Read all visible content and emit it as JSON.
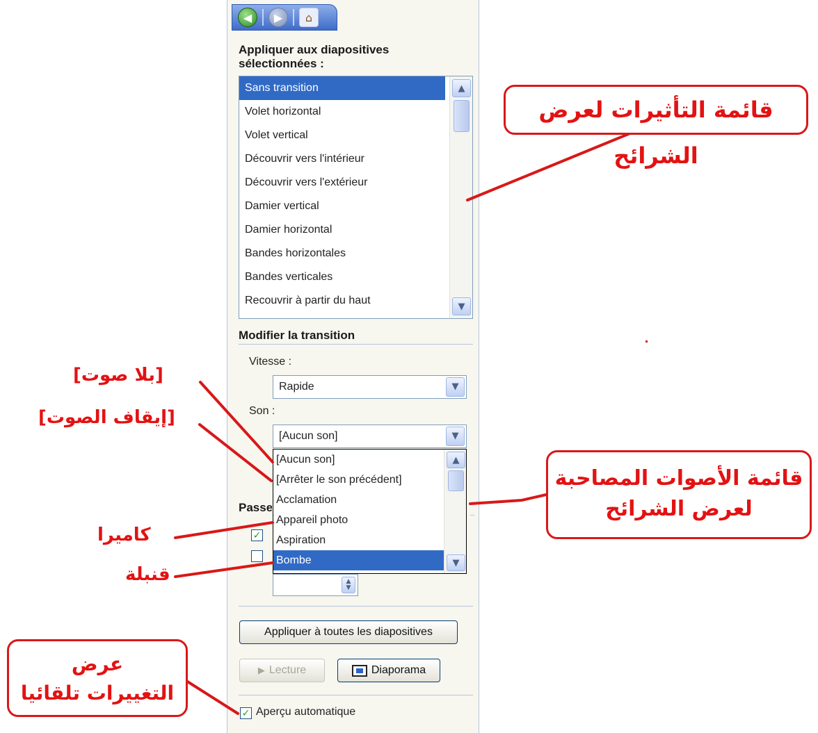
{
  "nav": {
    "back_icon": "◀",
    "forward_icon": "▶",
    "home_icon": "⌂"
  },
  "apply_section": {
    "title": "Appliquer aux diapositives sélectionnées :"
  },
  "transitions": {
    "items": [
      "Sans transition",
      "Volet horizontal",
      "Volet vertical",
      "Découvrir vers l'intérieur",
      "Découvrir vers l'extérieur",
      "Damier vertical",
      "Damier horizontal",
      "Bandes horizontales",
      "Bandes verticales",
      "Recouvrir à partir du haut"
    ],
    "selected_index": 0
  },
  "modify": {
    "title": "Modifier la transition",
    "speed_label": "Vitesse :",
    "speed_value": "Rapide",
    "sound_label": "Son :",
    "sound_value": "[Aucun son]"
  },
  "sound_list": {
    "items": [
      "[Aucun son]",
      "[Arrêter le son précédent]",
      "Acclamation",
      "Appareil photo",
      "Aspiration",
      "Bombe"
    ],
    "selected_index": 5
  },
  "advance": {
    "partial_label": "Passe"
  },
  "buttons": {
    "apply_all": "Appliquer à toutes les diapositives",
    "play": "Lecture",
    "slideshow": "Diaporama"
  },
  "auto_preview": {
    "label": "Aperçu automatique",
    "checked": true
  },
  "annotations": {
    "effects_list": "قائمة التأثيرات لعرض الشرائح",
    "no_sound": "[بلا صوت]",
    "stop_sound": "[إيقاف الصوت]",
    "sounds_list_line1": "قائمة الأصوات المصاحبة",
    "sounds_list_line2": "لعرض الشرائح",
    "camera": "كاميرا",
    "bomb": "قنبلة",
    "auto_preview_line1": "عرض",
    "auto_preview_line2": "التغييرات تلقائيا"
  },
  "colors": {
    "selection": "#316ac5",
    "annotation": "#e31212",
    "pane_bg": "#f7f6ef"
  }
}
